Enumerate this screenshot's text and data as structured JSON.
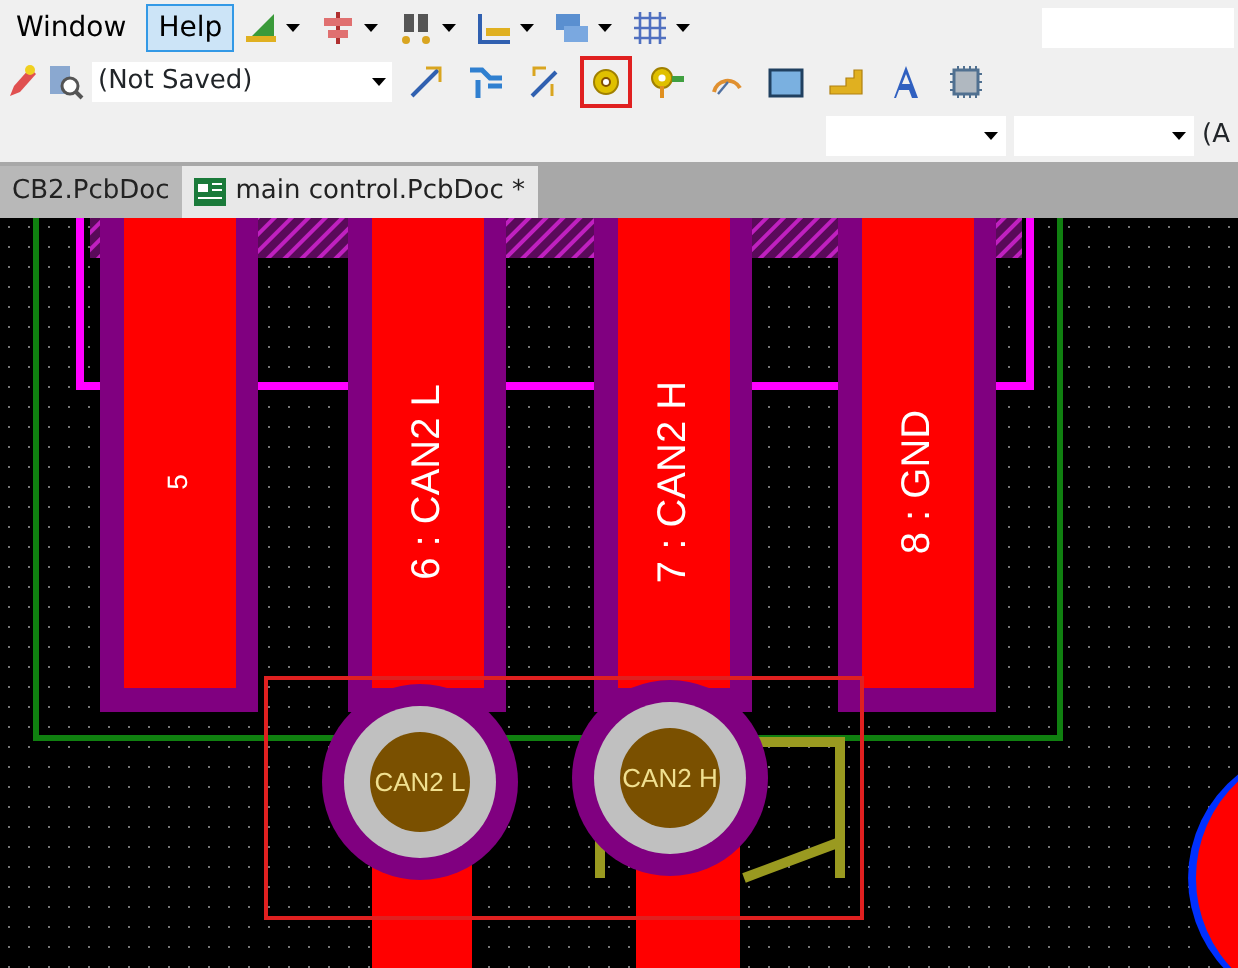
{
  "menu": [
    {
      "label": "Window",
      "selected": false
    },
    {
      "label": "Help",
      "selected": true
    }
  ],
  "toolbar_1": [
    {
      "kind": "ruler"
    },
    {
      "kind": "align"
    },
    {
      "kind": "select"
    },
    {
      "kind": "dimension"
    },
    {
      "kind": "room"
    },
    {
      "kind": "grid"
    }
  ],
  "toolbar_2": {
    "left": [
      {
        "kind": "pencil"
      },
      {
        "kind": "inspect"
      }
    ],
    "combo": {
      "value": "(Not Saved)"
    },
    "tools": [
      {
        "kind": "route",
        "highlighted": false
      },
      {
        "kind": "diffpair",
        "highlighted": false
      },
      {
        "kind": "multiroute",
        "highlighted": false
      },
      {
        "kind": "pad",
        "highlighted": true
      },
      {
        "kind": "via",
        "highlighted": false
      },
      {
        "kind": "arc",
        "highlighted": false
      },
      {
        "kind": "fill",
        "highlighted": false
      },
      {
        "kind": "polygon",
        "highlighted": false
      },
      {
        "kind": "text",
        "highlighted": false
      },
      {
        "kind": "component",
        "highlighted": false
      }
    ]
  },
  "toolbar_3": {
    "cut_text": "(A"
  },
  "tabs": [
    {
      "label": "CB2.PcbDoc",
      "selected": false
    },
    {
      "label": "main control.PcbDoc *",
      "selected": true
    }
  ],
  "pads": [
    {
      "label": "5"
    },
    {
      "label": "6 : CAN2 L"
    },
    {
      "label": "7 : CAN2 H"
    },
    {
      "label": "8 : GND"
    }
  ],
  "vias": [
    {
      "label": "CAN2 L"
    },
    {
      "label": "CAN2 H"
    }
  ]
}
